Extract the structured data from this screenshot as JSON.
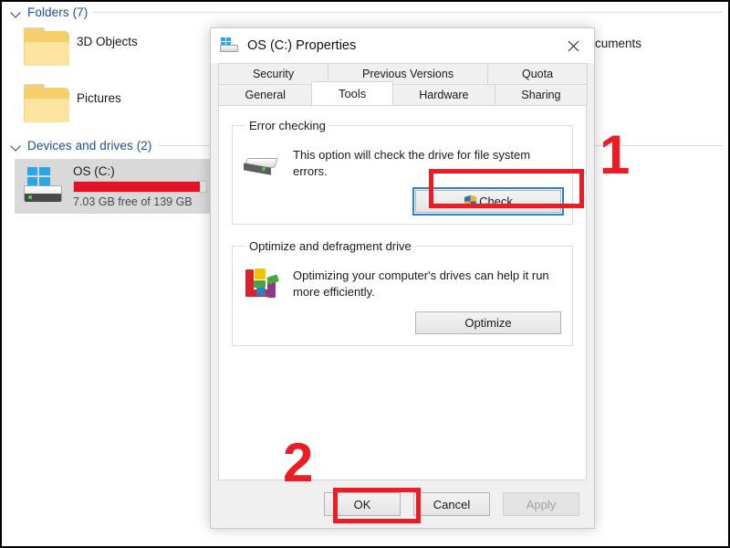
{
  "explorer": {
    "groups": [
      {
        "title": "Folders (7)"
      },
      {
        "title": "Devices and drives (2)"
      }
    ],
    "items": [
      {
        "label": "3D Objects",
        "icon": "folder-3d-objects-icon"
      },
      {
        "label": "Pictures",
        "icon": "folder-pictures-icon"
      }
    ],
    "partial_label": "cuments",
    "drive": {
      "name": "OS (C:)",
      "free_text": "7.03 GB free of 139 GB",
      "used_percent": 95,
      "bar_color": "#e81123",
      "icon": "hard-drive-windows-icon"
    }
  },
  "dialog": {
    "title": "OS (C:) Properties",
    "title_icon": "drive-properties-icon",
    "close_label": "close-icon",
    "tabs_top": [
      {
        "label": "Security",
        "active": false
      },
      {
        "label": "Previous Versions",
        "active": false
      },
      {
        "label": "Quota",
        "active": false
      }
    ],
    "tabs_bottom": [
      {
        "label": "General",
        "active": false
      },
      {
        "label": "Tools",
        "active": true
      },
      {
        "label": "Hardware",
        "active": false
      },
      {
        "label": "Sharing",
        "active": false
      }
    ],
    "error_checking": {
      "legend": "Error checking",
      "description": "This option will check the drive for file system errors.",
      "button_label": "Check",
      "button_icon": "uac-shield-icon",
      "icon": "disk-drive-icon"
    },
    "optimize": {
      "legend": "Optimize and defragment drive",
      "description": "Optimizing your computer's drives can help it run more efficiently.",
      "button_label": "Optimize",
      "icon": "defragment-blocks-icon"
    },
    "footer": {
      "ok_label": "OK",
      "cancel_label": "Cancel",
      "apply_label": "Apply",
      "apply_disabled": true
    }
  },
  "annotations": {
    "color": "#ed1c24",
    "step_one": "1",
    "step_two": "2"
  }
}
